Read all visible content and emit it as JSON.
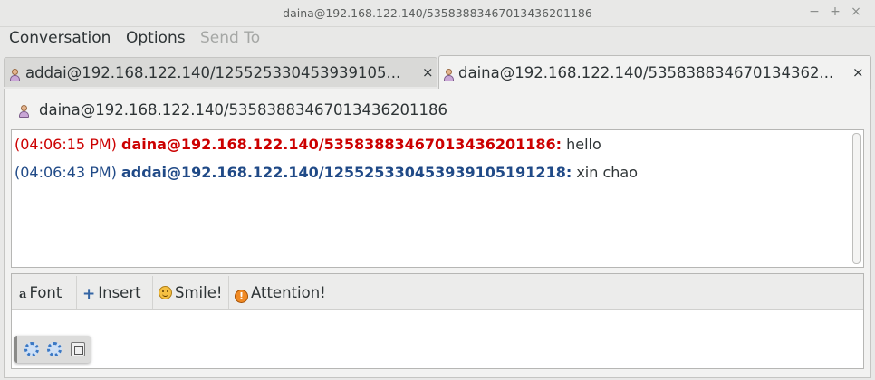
{
  "window": {
    "title": "daina@192.168.122.140/5358388346701343620118​6",
    "controls": {
      "minimize": "−",
      "maximize": "+",
      "close": "×"
    }
  },
  "menu": [
    {
      "label": "Conversation",
      "enabled": true
    },
    {
      "label": "Options",
      "enabled": true
    },
    {
      "label": "Send To",
      "enabled": false
    }
  ],
  "tabs": [
    {
      "label": "addai@192.168.122.140/125525330453939105...",
      "active": false,
      "icon": "buddy-icon",
      "close": "×"
    },
    {
      "label": "daina@192.168.122.140/535838834670134362...",
      "active": true,
      "icon": "buddy-icon",
      "close": "×"
    }
  ],
  "conversation": {
    "buddy_name": "daina@192.168.122.140/5358388346701343620118​6",
    "messages": [
      {
        "time": "(04:06:15 PM)",
        "sender": "daina@192.168.122.140/5358388346701343620118​6:",
        "text": "hello",
        "color": "#cc0000"
      },
      {
        "time": "(04:06:43 PM)",
        "sender": "addai@192.168.122.140/12552533045393910519121​8:",
        "text": "xin chao",
        "color": "#204a87"
      }
    ]
  },
  "format_toolbar": {
    "font": "Font",
    "insert": "Insert",
    "smile": "Smile!",
    "attention": "Attention!"
  },
  "colors": {
    "local_user": "#cc0000",
    "remote_user": "#204a87",
    "insert_icon": "#3465a4"
  }
}
